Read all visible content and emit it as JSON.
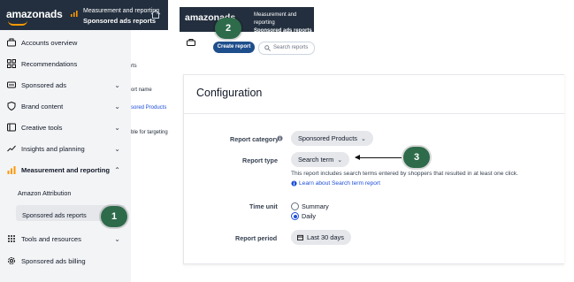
{
  "left_panel": {
    "logo": "amazonads",
    "header_line1": "Measurement and reporting",
    "header_line2": "Sponsored ads reports",
    "nav": [
      {
        "label": "Accounts overview",
        "icon": "briefcase-icon",
        "chevron": ""
      },
      {
        "label": "Recommendations",
        "icon": "grid-icon",
        "chevron": ""
      },
      {
        "label": "Sponsored ads",
        "icon": "megaphone-icon",
        "chevron": "⌄"
      },
      {
        "label": "Brand content",
        "icon": "shield-icon",
        "chevron": "⌄"
      },
      {
        "label": "Creative tools",
        "icon": "palette-icon",
        "chevron": "⌄"
      },
      {
        "label": "Insights and planning",
        "icon": "trend-icon",
        "chevron": "⌄"
      },
      {
        "label": "Measurement and reporting",
        "icon": "bar-chart-icon",
        "chevron": "⌃"
      },
      {
        "label": "Tools and resources",
        "icon": "apps-icon",
        "chevron": "⌄"
      },
      {
        "label": "Sponsored ads billing",
        "icon": "gear-icon",
        "chevron": ""
      }
    ],
    "subitems": [
      "Amazon Attribution",
      "Sponsored ads reports"
    ],
    "behind_texts": [
      "rts",
      "ort name",
      "sored Products",
      "ble for targeting"
    ]
  },
  "inset": {
    "logo": "amazonads",
    "header_line1": "Measurement and reporting",
    "header_line2": "Sponsored ads reports",
    "create_button": "Create report",
    "search_placeholder": "Search reports"
  },
  "configuration": {
    "title": "Configuration",
    "report_category_label": "Report category",
    "report_category_value": "Sponsored Products",
    "report_type_label": "Report type",
    "report_type_value": "Search term",
    "report_type_help": "This report includes search terms entered by shoppers that resulted in at least one click.",
    "learn_link": "Learn about Search term report",
    "time_unit_label": "Time unit",
    "time_unit_options": [
      "Summary",
      "Daily"
    ],
    "time_unit_selected": "Daily",
    "report_period_label": "Report period",
    "report_period_value": "Last 30 days"
  },
  "badges": [
    "1",
    "2",
    "3"
  ],
  "colors": {
    "header": "#232f3e",
    "accent": "#ff9900",
    "badge": "#2e6b4a",
    "primary": "#1f4e8c",
    "link": "#1d4ed8"
  }
}
